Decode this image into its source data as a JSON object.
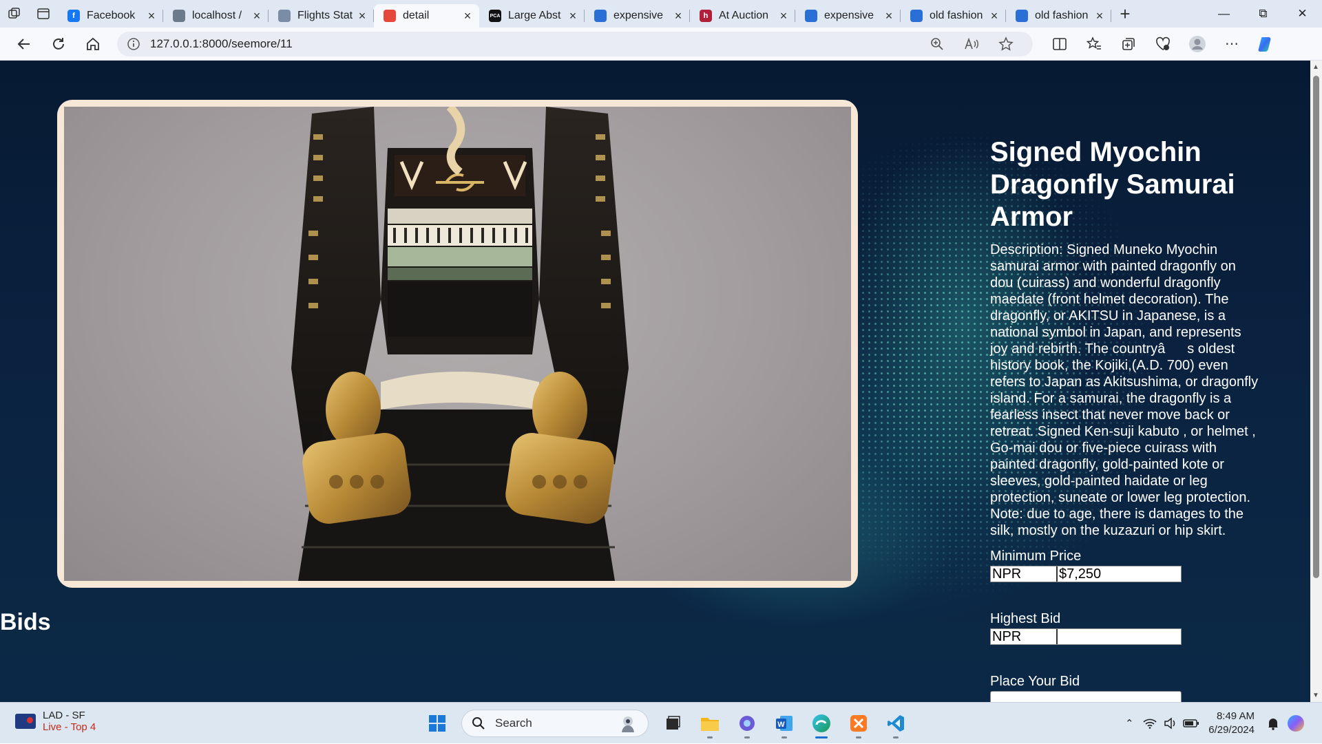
{
  "browser": {
    "tabs": [
      {
        "title": "Facebook",
        "favicon": "facebook-favicon",
        "color": "#1877f2",
        "glyph": "f"
      },
      {
        "title": "localhost /",
        "favicon": "phpmyadmin-favicon",
        "color": "#6c7a8a",
        "glyph": ""
      },
      {
        "title": "Flights Stat",
        "favicon": "flights-favicon",
        "color": "#7b8da6",
        "glyph": ""
      },
      {
        "title": "detail",
        "favicon": "chrome-favicon",
        "color": "#e5483a",
        "glyph": "",
        "active": true
      },
      {
        "title": "Large Abst",
        "favicon": "pca-favicon",
        "color": "#111111",
        "glyph": "PCA"
      },
      {
        "title": "expensive",
        "favicon": "edge-favicon",
        "color": "#2a6fd6",
        "glyph": ""
      },
      {
        "title": "At Auction",
        "favicon": "hibid-favicon",
        "color": "#b0203a",
        "glyph": "h"
      },
      {
        "title": "expensive",
        "favicon": "edge-favicon",
        "color": "#2a6fd6",
        "glyph": ""
      },
      {
        "title": "old fashion",
        "favicon": "edge-favicon",
        "color": "#2a6fd6",
        "glyph": ""
      },
      {
        "title": "old fashion",
        "favicon": "edge-favicon",
        "color": "#2a6fd6",
        "glyph": ""
      }
    ],
    "url": "127.0.0.1:8000/seemore/11"
  },
  "item": {
    "title": "Signed Myochin Dragonfly Samurai Armor",
    "description": "Description: Signed Muneko Myochin samurai armor with painted dragonfly on dou (cuirass) and wonderful dragonfly maedate (front helmet decoration). The dragonfly, or AKITSU in Japanese, is a national symbol in Japan, and represents joy and rebirth. The countryâs oldest history book, the Kojiki,(A.D. 700) even refers to Japan as Akitsushima, or dragonfly island. For a samurai, the dragonfly is a fearless insect that never move back or retreat. Signed Ken-suji kabuto , or helmet , Go-mai dou or five-piece cuirass with painted dragonfly, gold-painted kote or sleeves, gold-painted haidate or leg protection, suneate or lower leg protection. Note: due to age, there is damages to the silk, mostly on the kuzazuri or hip skirt.",
    "min_price_label": "Minimum Price",
    "min_price_currency": "NPR",
    "min_price_value": "$7,250",
    "highest_bid_label": "Highest Bid",
    "highest_bid_currency": "NPR",
    "highest_bid_value": "",
    "place_bid_label": "Place Your Bid"
  },
  "bids_heading": "Bids",
  "taskbar": {
    "widget_line1": "LAD - SF",
    "widget_line2": "Live - Top 4",
    "search_placeholder": "Search",
    "time": "8:49 AM",
    "date": "6/29/2024"
  },
  "colors": {
    "page_bg": "#0a2240",
    "frame": "#f6e7d7",
    "accent": "#1a6fd4"
  }
}
